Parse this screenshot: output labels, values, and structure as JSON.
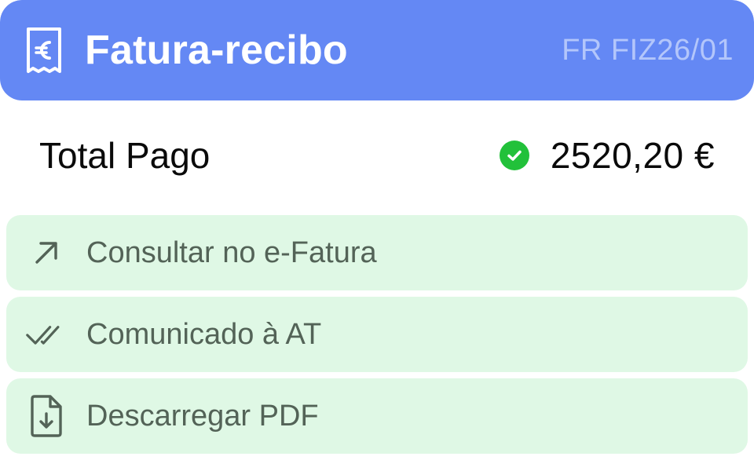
{
  "header": {
    "icon": "receipt-euro-icon",
    "title": "Fatura-recibo",
    "document_number": "FR FIZ26/01",
    "background_color": "#6488f4"
  },
  "total": {
    "label": "Total Pago",
    "status_icon": "check-circle-icon",
    "status_color": "#22c13a",
    "amount": "2520,20 €"
  },
  "actions": [
    {
      "icon": "arrow-up-right-icon",
      "label": "Consultar no e-Fatura"
    },
    {
      "icon": "double-check-icon",
      "label": "Comunicado à AT"
    },
    {
      "icon": "file-download-icon",
      "label": "Descarregar PDF"
    }
  ],
  "colors": {
    "action_background": "#dff8e5",
    "action_text": "#536357"
  }
}
